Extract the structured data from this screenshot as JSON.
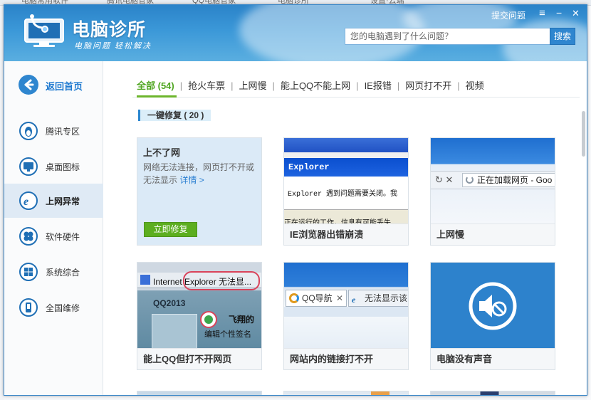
{
  "app": {
    "brand": "电脑诊所",
    "slogan": "电脑问题 轻松解决",
    "submit_label": "提交问题",
    "menu_icon": "≡",
    "minimize_icon": "−",
    "close_icon": "✕"
  },
  "search": {
    "placeholder": "您的电脑遇到了什么问题？",
    "button_label": "搜索"
  },
  "sidebar": {
    "back_label": "返回首页",
    "items": [
      {
        "label": "腾讯专区",
        "icon": "penguin-icon"
      },
      {
        "label": "桌面图标",
        "icon": "monitor-icon"
      },
      {
        "label": "上网异常",
        "icon": "ie-icon",
        "active": true
      },
      {
        "label": "软件硬件",
        "icon": "puzzle-icon"
      },
      {
        "label": "系统综合",
        "icon": "windows-icon"
      },
      {
        "label": "全国维修",
        "icon": "phone-icon"
      }
    ]
  },
  "tabs": [
    {
      "label": "全部 (54)",
      "active": true
    },
    {
      "label": "抢火车票"
    },
    {
      "label": "上网慢"
    },
    {
      "label": "能上QQ不能上网"
    },
    {
      "label": "IE报错"
    },
    {
      "label": "网页打不开"
    },
    {
      "label": "视频"
    }
  ],
  "section": {
    "title": "一键修复 ( 20 )"
  },
  "featured": {
    "title": "上不了网",
    "desc": "网络无法连接，网页打不开或无法显示",
    "link": "详情 >",
    "button": "立即修复"
  },
  "cards": [
    {
      "title": "IE浏览器出错崩溃",
      "thumb_title": "Explorer",
      "thumb_text": "Explorer 遇到问题需要关闭。我",
      "thumb_text2": "正在运行的工作，信息有可能丢失"
    },
    {
      "title": "上网慢",
      "thumb_text": "正在加载网页 - Goo",
      "thumb_icons": "↻ ✕"
    },
    {
      "title": "能上QQ但打不开网页",
      "thumb_bar": "Internet Explorer 无法显...",
      "thumb_qq": "QQ2013",
      "thumb_name": "飞翔的",
      "thumb_sign": "编辑个性签名"
    },
    {
      "title": "网站内的链接打不开",
      "thumb_tab1": "QQ导航",
      "thumb_tab2": "无法显示该"
    },
    {
      "title": "电脑没有声音"
    }
  ],
  "bg": {
    "tab1": "电脑常用软件",
    "tab2": "腾讯电脑管家",
    "tab3": "QQ电脑管家",
    "tab4": "电脑诊所",
    "tab5": "设置·云端"
  },
  "colors": {
    "accent": "#2f86cf",
    "active_tab": "#4ea51f",
    "fix_button": "#5cae1f"
  }
}
